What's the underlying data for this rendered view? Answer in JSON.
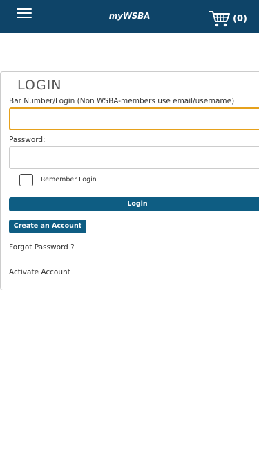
{
  "header": {
    "brand": "myWSBA",
    "menu_icon": "hamburger-menu-icon",
    "cart_icon": "shopping-cart-icon",
    "cart_count": "(0)"
  },
  "login": {
    "title": "LOGIN",
    "username_label": "Bar Number/Login (Non WSBA-members use email/username)",
    "username_value": "",
    "password_label": "Password:",
    "password_value": "",
    "remember_label": "Remember Login",
    "remember_checked": false,
    "login_button": "Login",
    "create_account_button": "Create an Account",
    "forgot_password_link": "Forgot Password ?",
    "activate_account_link": "Activate Account"
  },
  "colors": {
    "header_bg": "#0e4468",
    "button_bg": "#0e5d83",
    "focus_border": "#e6a11c"
  }
}
